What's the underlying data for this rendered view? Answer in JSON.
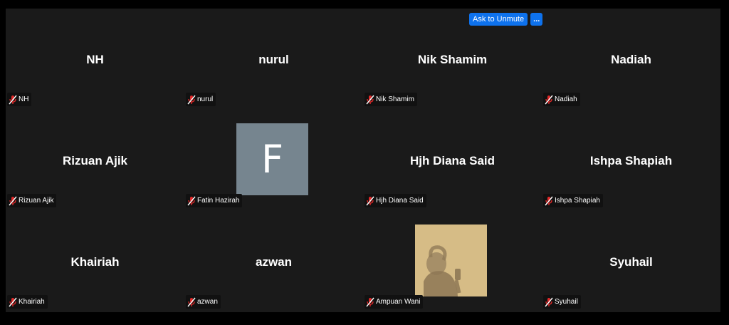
{
  "toolbar": {
    "ask_to_unmute": "Ask to Unmute",
    "more": "..."
  },
  "participants": [
    {
      "display": "NH",
      "label": "NH"
    },
    {
      "display": "nurul",
      "label": "nurul"
    },
    {
      "display": "Nik Shamim",
      "label": "Nik Shamim"
    },
    {
      "display": "Nadiah",
      "label": "Nadiah"
    },
    {
      "display": "Rizuan Ajik",
      "label": "Rizuan Ajik"
    },
    {
      "display": "",
      "label": "Fatin Hazirah",
      "avatar_letter": "F"
    },
    {
      "display": "Hjh Diana Said",
      "label": "Hjh Diana Said"
    },
    {
      "display": "Ishpa Shapiah",
      "label": "Ishpa Shapiah"
    },
    {
      "display": "Khairiah",
      "label": "Khairiah"
    },
    {
      "display": "azwan",
      "label": "azwan"
    },
    {
      "display": "",
      "label": "Ampuan Wani"
    },
    {
      "display": "Syuhail",
      "label": "Syuhail"
    }
  ],
  "colors": {
    "tile_bg": "#1a1a1a",
    "accent": "#0e72ed",
    "muted_icon": "#e02828"
  }
}
